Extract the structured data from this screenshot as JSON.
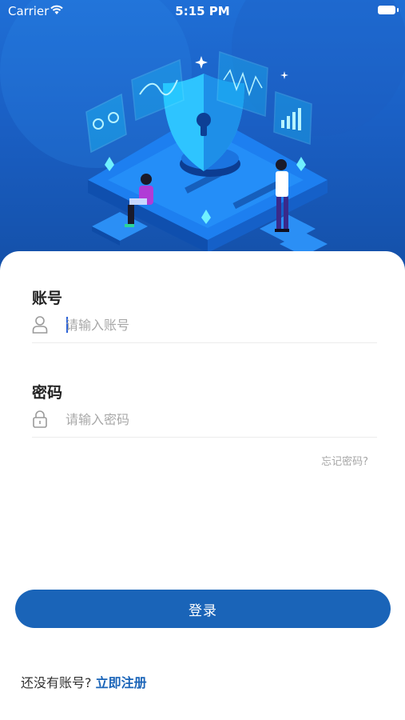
{
  "status_bar": {
    "carrier": "Carrier",
    "time": "5:15 PM"
  },
  "form": {
    "account": {
      "label": "账号",
      "placeholder": "请输入账号",
      "icon": "user-icon"
    },
    "password": {
      "label": "密码",
      "placeholder": "请输入密码",
      "icon": "lock-icon"
    },
    "forgot_label": "忘记密码?"
  },
  "login_button": {
    "label": "登录"
  },
  "register": {
    "prompt": "还没有账号?",
    "link": "立即注册"
  },
  "colors": {
    "hero": "#1a5fc4",
    "accent": "#1a64b8",
    "placeholder": "#a8a8a8"
  }
}
